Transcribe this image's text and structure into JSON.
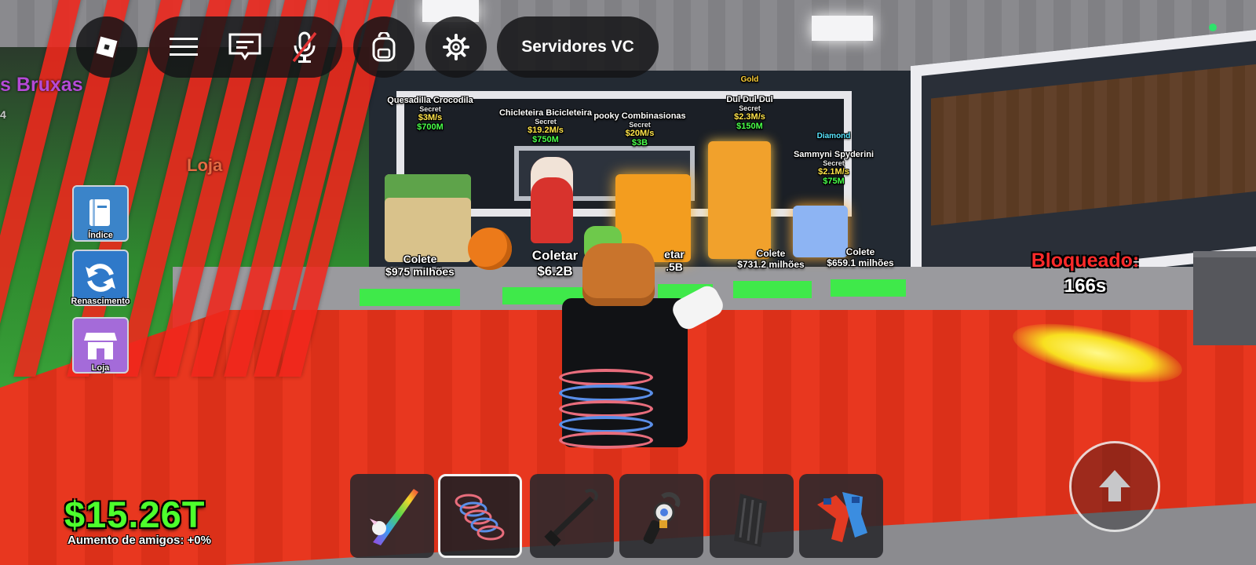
{
  "hud": {
    "server_label": "Servidores VC",
    "money": "$15.26T",
    "friend_boost": "Aumento de amigos: +0%",
    "blocked_label": "Bloqueado:",
    "blocked_countdown": "166s"
  },
  "top_bar_icons": [
    "roblox-logo-icon",
    "menu-icon",
    "chat-icon",
    "mic-muted-icon",
    "backpack-icon",
    "settings-icon"
  ],
  "side_menu": [
    {
      "label": "Índice",
      "icon": "book-icon",
      "color": "#3b84c9"
    },
    {
      "label": "Renascimento",
      "icon": "refresh-icon",
      "color": "#2f79c9"
    },
    {
      "label": "Loja",
      "icon": "shop-icon",
      "color": "#a46bd9"
    }
  ],
  "world_text": {
    "left_title": "s Bruxas",
    "left_sub": "4",
    "loja_sign": "Loja"
  },
  "brainrots": [
    {
      "name": "Quesadilla Crocodila",
      "rarity": "Secret",
      "rate": "$3M/s",
      "price": "$700M"
    },
    {
      "name": "Chicleteira Bicicleteira",
      "rarity": "Secret",
      "rate": "$19.2M/s",
      "price": "$750M"
    },
    {
      "name": "pooky Combinasionas",
      "rarity": "Secret",
      "rate": "$20M/s",
      "price": "$3B"
    },
    {
      "tier": "Gold",
      "name": "Dul Dul Dul",
      "rarity": "Secret",
      "rate": "$2.3M/s",
      "price": "$150M"
    },
    {
      "tier": "Diamond",
      "name": "Sammyni Spyderini",
      "rarity": "Secret",
      "rate": "$2.1M/s",
      "price": "$75M"
    }
  ],
  "collect_plates": [
    {
      "label": "Colete",
      "value": "$975 milhões"
    },
    {
      "label": "Coletar",
      "value": "$6.2B"
    },
    {
      "label": "etar",
      "value": ".5B"
    },
    {
      "label": "Colete",
      "value": "$731.2 milhões"
    },
    {
      "label": "Colete",
      "value": "$659.1 milhões"
    }
  ],
  "hotbar": [
    {
      "item": "unicorn-sword",
      "icon": "rainbow-sword-icon",
      "active": false
    },
    {
      "item": "speed-coil",
      "icon": "coil-icon",
      "active": true
    },
    {
      "item": "grapple-hook",
      "icon": "grapple-icon",
      "active": false
    },
    {
      "item": "paintball-gun",
      "icon": "blaster-icon",
      "active": false
    },
    {
      "item": "invisibility-cloak",
      "icon": "cloak-icon",
      "active": false
    },
    {
      "item": "body-swap",
      "icon": "swap-icon",
      "active": false
    }
  ],
  "colors": {
    "money": "#4dff2c",
    "blocked": "#ff2a2a",
    "rate": "#ffe44a",
    "price": "#49ff4a"
  }
}
